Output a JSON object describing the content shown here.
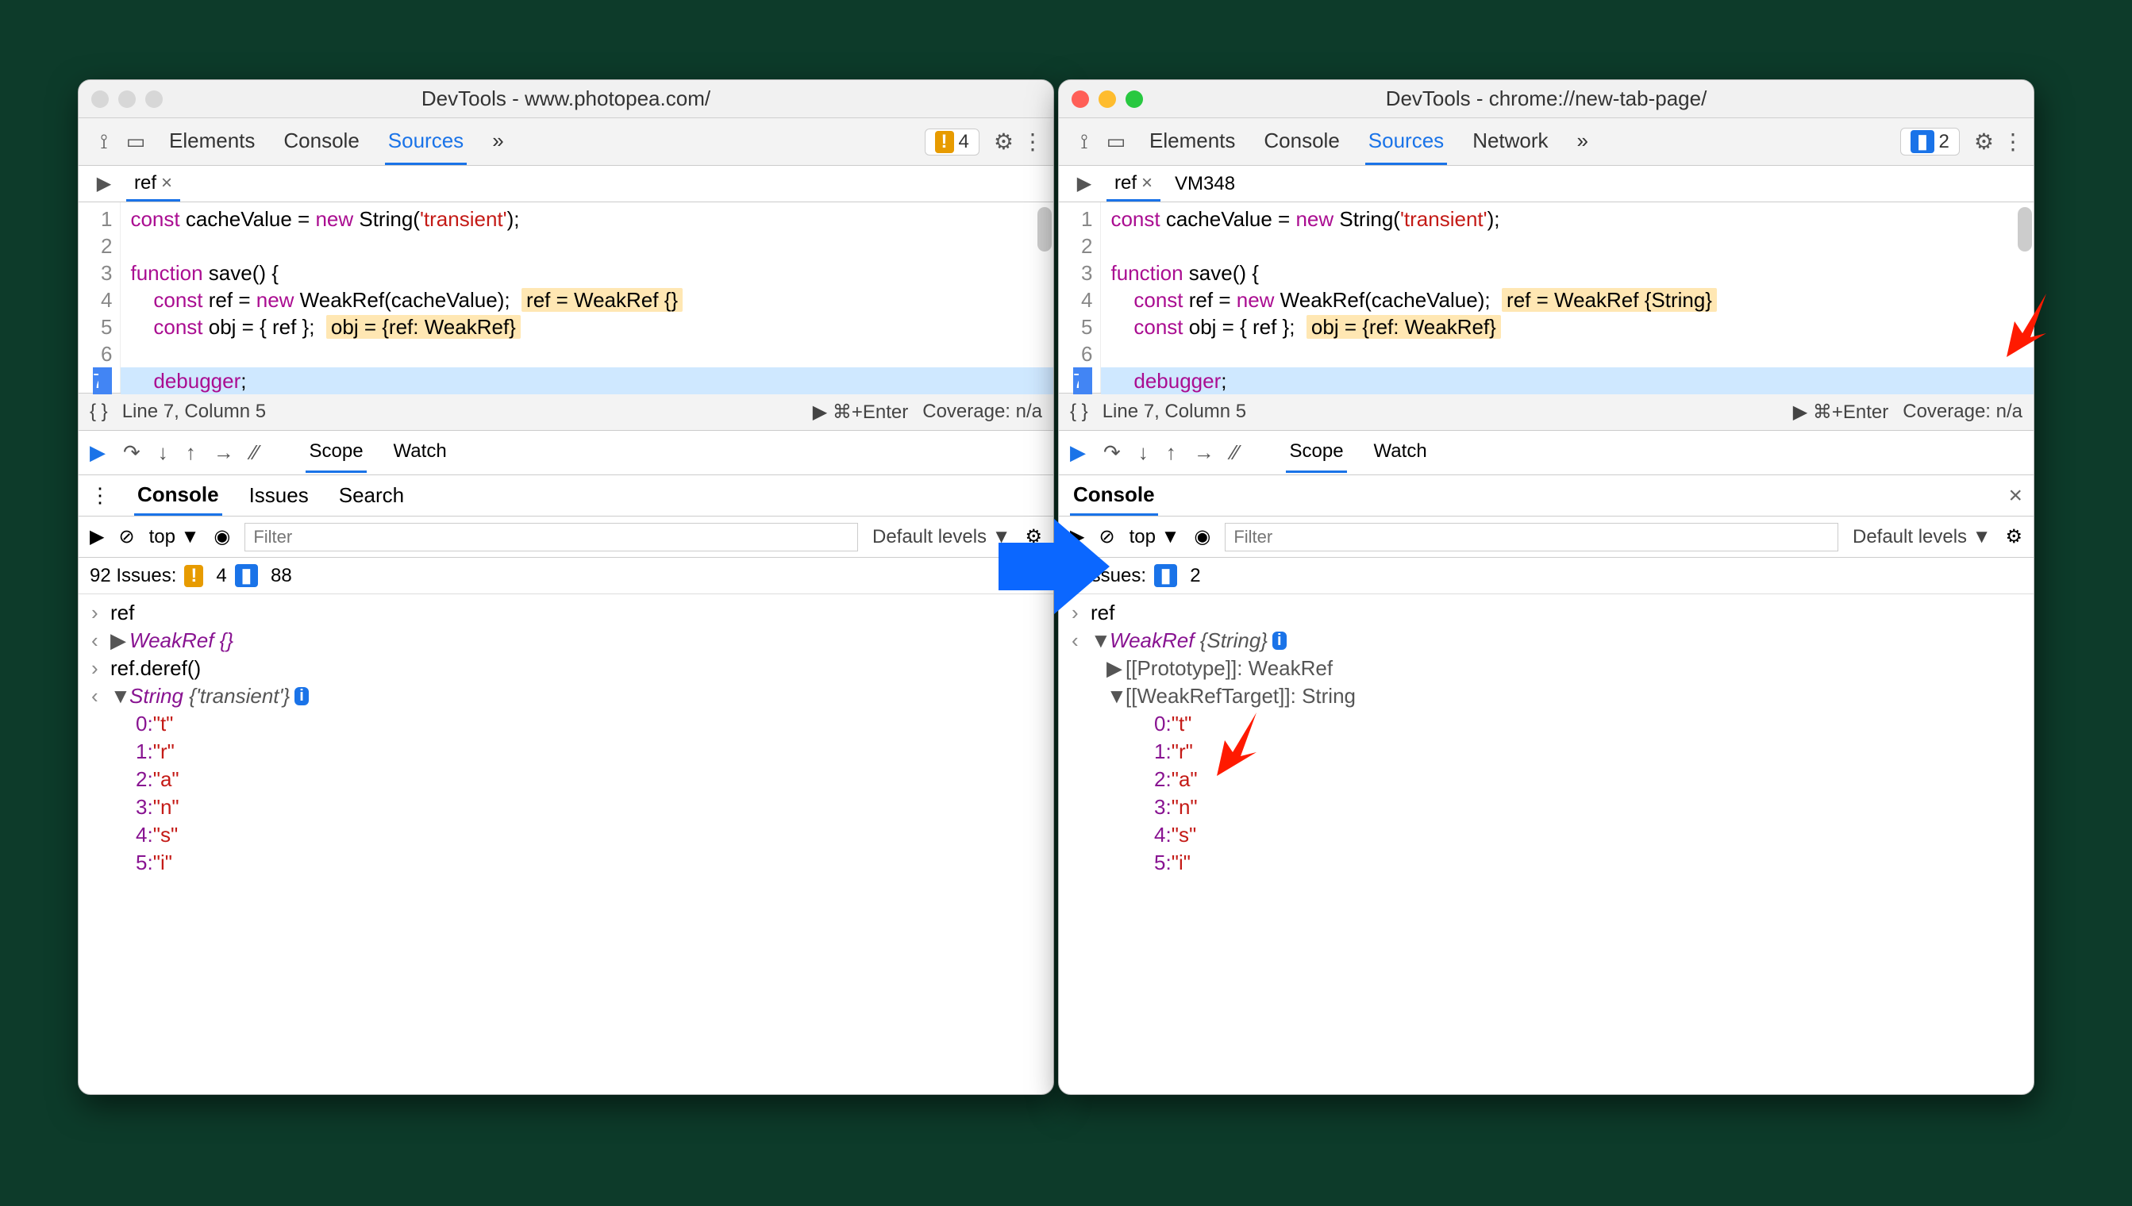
{
  "left": {
    "title": "DevTools - www.photopea.com/",
    "tabs": [
      "Elements",
      "Console",
      "Sources"
    ],
    "active_tab": "Sources",
    "more_tabs_glyph": "»",
    "toolbar_badge": {
      "icon": "!",
      "count": "4"
    },
    "file_tabs": [
      {
        "name": "ref",
        "active": true
      }
    ],
    "code": {
      "line1": "const cacheValue = new String('transient');",
      "line3": "function save() {",
      "line4_code": "    const ref = new WeakRef(cacheValue);",
      "line4_val": "ref = WeakRef {}",
      "line5_code": "    const obj = { ref };",
      "line5_val": "obj = {ref: WeakRef}",
      "line7": "    debugger;"
    },
    "status": {
      "pos": "Line 7, Column 5",
      "shortcut": "▶ ⌘+Enter",
      "coverage": "Coverage: n/a"
    },
    "dbg_tabs": [
      "Scope",
      "Watch"
    ],
    "dbg_active": "Scope",
    "drawer_tabs": [
      "Console",
      "Issues",
      "Search"
    ],
    "drawer_active": "Console",
    "console_filter_placeholder": "Filter",
    "context": "top",
    "levels": "Default levels",
    "issues": {
      "label": "92 Issues:",
      "warn": "4",
      "info": "88"
    },
    "console": {
      "input1": "ref",
      "out1": "WeakRef {}",
      "input2": "ref.deref()",
      "out2_name": "String",
      "out2_preview": "{'transient'}",
      "chars": [
        "t",
        "r",
        "a",
        "n",
        "s",
        "i"
      ],
      "char_indices": [
        "0",
        "1",
        "2",
        "3",
        "4",
        "5"
      ]
    }
  },
  "right": {
    "title": "DevTools - chrome://new-tab-page/",
    "tabs": [
      "Elements",
      "Console",
      "Sources",
      "Network"
    ],
    "active_tab": "Sources",
    "more_tabs_glyph": "»",
    "toolbar_badge": {
      "icon": "▮",
      "count": "2"
    },
    "file_tabs": [
      {
        "name": "ref",
        "active": true
      },
      {
        "name": "VM348",
        "active": false
      }
    ],
    "code": {
      "line1": "const cacheValue = new String('transient');",
      "line3": "function save() {",
      "line4_code": "    const ref = new WeakRef(cacheValue);",
      "line4_val": "ref = WeakRef {String}",
      "line5_code": "    const obj = { ref };",
      "line5_val": "obj = {ref: WeakRef}",
      "line7": "    debugger;"
    },
    "status": {
      "pos": "Line 7, Column 5",
      "shortcut": "▶ ⌘+Enter",
      "coverage": "Coverage: n/a"
    },
    "dbg_tabs": [
      "Scope",
      "Watch"
    ],
    "dbg_active": "Scope",
    "drawer_tabs": [
      "Console"
    ],
    "drawer_active": "Console",
    "console_filter_placeholder": "Filter",
    "context": "top",
    "levels": "Default levels",
    "issues": {
      "label": "2 Issues:",
      "info": "2"
    },
    "console": {
      "input1": "ref",
      "out1_name": "WeakRef",
      "out1_preview": "{String}",
      "proto_label": "[[Prototype]]",
      "proto_val": "WeakRef",
      "target_label": "[[WeakRefTarget]]",
      "target_val": "String",
      "chars": [
        "t",
        "r",
        "a",
        "n",
        "s",
        "i"
      ],
      "char_indices": [
        "0",
        "1",
        "2",
        "3",
        "4",
        "5"
      ]
    }
  }
}
